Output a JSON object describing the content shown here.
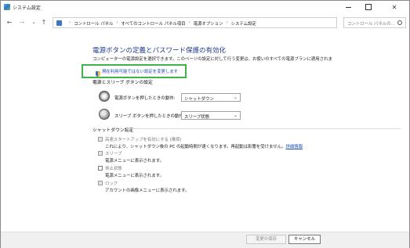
{
  "window": {
    "title": "システム設定"
  },
  "address": {
    "crumbs": [
      "コントロール パネル",
      "すべてのコントロール パネル項目",
      "電源オプション",
      "システム設定"
    ],
    "search_placeholder": "コントロール パネルの..."
  },
  "main": {
    "title": "電源ボタンの定義とパスワード保護の有効化",
    "description": "コンピューターの電源設定を選択できます。このページの設定に対して行う変更は、お使いのすべての電源プランに適用されま",
    "change_link": "現在利用可能ではない設定を変更します",
    "section_title": "電源とスリープ ボタンの設定",
    "power_button_label": "電源ボタンを押したときの動作:",
    "power_button_value": "シャットダウン",
    "sleep_button_label": "スリープ ボタンを押したときの動作:",
    "sleep_button_value": "スリープ状態",
    "shutdown_title": "シャットダウン設定",
    "options": [
      {
        "label": "高速スタートアップを有効にする (推奨)",
        "desc": "これにより、シャットダウン後の PC の起動時間が速くなります。再起動は影響を受けません。",
        "link": "詳細情報",
        "checked": true
      },
      {
        "label": "スリープ",
        "desc": "電源メニューに表示されます。",
        "checked": true
      },
      {
        "label": "休止状態",
        "desc": "電源メニューに表示されます。",
        "checked": false
      },
      {
        "label": "ロック",
        "desc": "アカウントの画像メニューに表示されます。",
        "checked": true
      }
    ]
  },
  "footer": {
    "save_label": "変更の保存",
    "cancel_label": "キャンセル"
  },
  "colors": {
    "highlight": "#3fb44a",
    "link": "#1f4fb5",
    "title": "#1e3a8a"
  }
}
